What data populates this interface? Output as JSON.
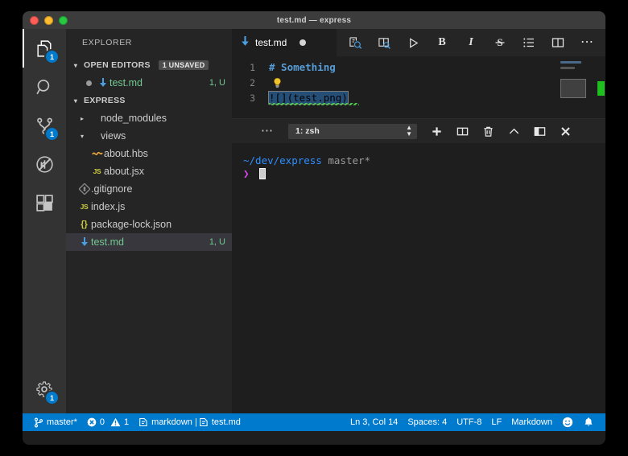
{
  "window": {
    "title": "test.md — express",
    "traffic_lights": [
      "close",
      "minimize",
      "maximize"
    ]
  },
  "activity_bar": {
    "items": [
      {
        "name": "explorer",
        "icon": "files-icon",
        "badge": "1",
        "active": true
      },
      {
        "name": "search",
        "icon": "search-icon",
        "badge": "",
        "active": false
      },
      {
        "name": "source-control",
        "icon": "source-control-icon",
        "badge": "1",
        "active": false
      },
      {
        "name": "run-and-debug",
        "icon": "no-debug-icon",
        "badge": "",
        "active": false
      },
      {
        "name": "extensions",
        "icon": "extensions-icon",
        "badge": "",
        "active": false
      }
    ],
    "bottom": [
      {
        "name": "manage-settings",
        "icon": "gear-icon",
        "badge": "1"
      }
    ]
  },
  "sidebar": {
    "title": "EXPLORER",
    "open_editors": {
      "label": "OPEN EDITORS",
      "badge": "1 UNSAVED",
      "twisty": "▾",
      "items": [
        {
          "label": "test.md",
          "meta": "1, U",
          "icon": "markdown-icon",
          "dirty": true,
          "selected": false
        }
      ]
    },
    "workspace": {
      "label": "EXPRESS",
      "twisty": "▾",
      "items": [
        {
          "label": "node_modules",
          "icon": "folder-icon",
          "twisty": "▸",
          "indent": 1,
          "meta": "",
          "selected": false
        },
        {
          "label": "views",
          "icon": "folder-icon",
          "twisty": "▾",
          "indent": 1,
          "meta": "",
          "selected": false
        },
        {
          "label": "about.hbs",
          "icon": "handlebars-icon",
          "twisty": "",
          "indent": 2,
          "meta": "",
          "selected": false
        },
        {
          "label": "about.jsx",
          "icon": "js-icon",
          "twisty": "",
          "indent": 2,
          "meta": "",
          "selected": false
        },
        {
          "label": ".gitignore",
          "icon": "git-icon",
          "twisty": "",
          "indent": 1,
          "meta": "",
          "selected": false
        },
        {
          "label": "index.js",
          "icon": "js-icon",
          "twisty": "",
          "indent": 1,
          "meta": "",
          "selected": false
        },
        {
          "label": "package-lock.json",
          "icon": "json-icon",
          "twisty": "",
          "indent": 1,
          "meta": "",
          "selected": false
        },
        {
          "label": "test.md",
          "icon": "markdown-icon",
          "twisty": "",
          "indent": 1,
          "meta": "1, U",
          "selected": true
        }
      ]
    }
  },
  "editor": {
    "tab": {
      "label": "test.md",
      "icon": "markdown-icon",
      "dirty": true
    },
    "actions": [
      {
        "name": "open-preview",
        "icon": "preview-search-icon"
      },
      {
        "name": "open-preview-to-side",
        "icon": "preview-side-icon"
      },
      {
        "name": "run-markdown",
        "icon": "play-icon"
      },
      {
        "name": "bold",
        "icon": "bold-icon",
        "label": "B"
      },
      {
        "name": "italic",
        "icon": "italic-icon",
        "label": "I"
      },
      {
        "name": "strikethrough",
        "icon": "strikethrough-icon",
        "label": "S"
      },
      {
        "name": "bullet-list",
        "icon": "list-icon"
      },
      {
        "name": "split-editor",
        "icon": "split-editor-icon"
      },
      {
        "name": "more-actions",
        "icon": "ellipsis-icon",
        "label": "⋯"
      }
    ],
    "lines": [
      {
        "number": "1",
        "text": "# Something",
        "kind": "heading"
      },
      {
        "number": "2",
        "text": "",
        "kind": "lightbulb"
      },
      {
        "number": "3",
        "text": "![](test.png)",
        "kind": "selected-link"
      }
    ],
    "minimap": {
      "marker_color": "#1fbf1f"
    }
  },
  "panel": {
    "more_label": "⋯",
    "terminal_select": {
      "value": "1: zsh"
    },
    "actions": [
      {
        "name": "new-terminal",
        "icon": "plus-icon"
      },
      {
        "name": "split-terminal",
        "icon": "split-icon"
      },
      {
        "name": "kill-terminal",
        "icon": "trash-icon"
      },
      {
        "name": "maximize-panel",
        "icon": "chevron-up-icon"
      },
      {
        "name": "toggle-panel-position",
        "icon": "panel-icon"
      },
      {
        "name": "close-panel",
        "icon": "close-icon"
      }
    ],
    "terminal": {
      "path": "~/dev/express",
      "branch": "master*",
      "prompt": "❯",
      "input": ""
    }
  },
  "status_bar": {
    "left": [
      {
        "name": "branch",
        "icon": "git-branch-icon",
        "label": "master*"
      },
      {
        "name": "problems",
        "icon": "error-warning-icon",
        "errors": "0",
        "warnings": "1"
      },
      {
        "name": "markdown-lint",
        "icon": "preview-icon",
        "label": "markdown | "
      },
      {
        "name": "active-file",
        "icon": "preview-icon",
        "label": "test.md"
      }
    ],
    "right": [
      {
        "name": "cursor-position",
        "label": "Ln 3, Col 14"
      },
      {
        "name": "indentation",
        "label": "Spaces: 4"
      },
      {
        "name": "encoding",
        "label": "UTF-8"
      },
      {
        "name": "eol",
        "label": "LF"
      },
      {
        "name": "language-mode",
        "label": "Markdown"
      },
      {
        "name": "feedback-smiley",
        "icon": "smiley-icon",
        "label": ""
      },
      {
        "name": "notifications-bell",
        "icon": "bell-icon",
        "label": ""
      }
    ]
  },
  "colors": {
    "accent": "#007acc",
    "badge": "#007acc",
    "dirty_green": "#73c991",
    "heading_blue": "#569cd6",
    "terminal_path": "#2e8fff",
    "terminal_prompt": "#d946ef",
    "minimap_marker": "#1fbf1f"
  }
}
